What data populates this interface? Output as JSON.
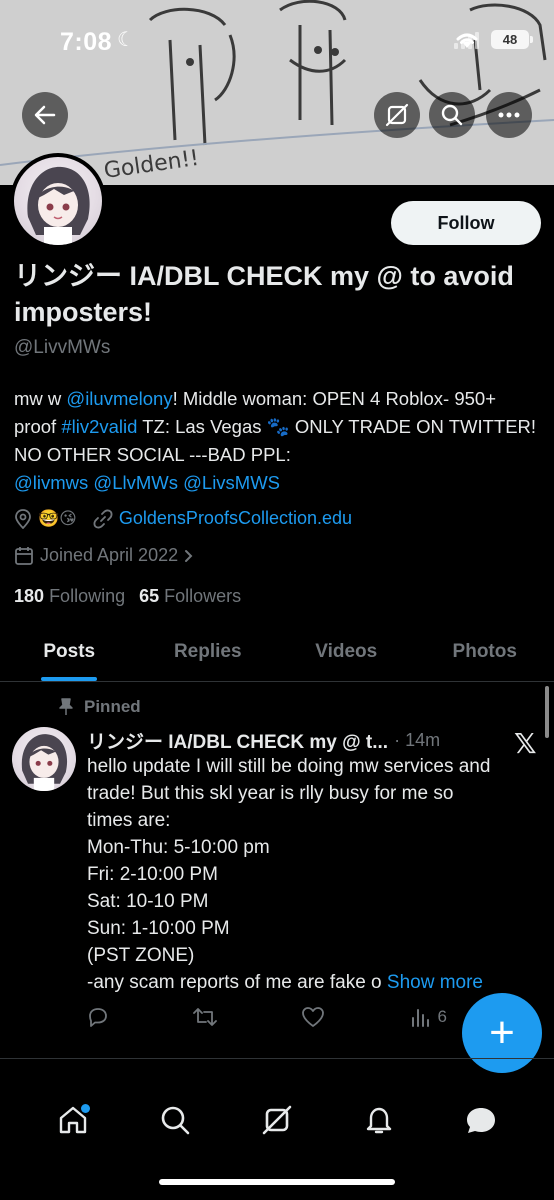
{
  "status_bar": {
    "time": "7:08",
    "battery": "48"
  },
  "banner": {
    "doodle_text": "Golden!!"
  },
  "profile": {
    "follow_label": "Follow",
    "display_name": "リンジー IA/DBL CHECK my @ to avoid imposters!",
    "handle": "@LivvMWs",
    "bio": {
      "p1": "mw w ",
      "mention1": "@iluvmelony",
      "p2": "! Middle woman: OPEN 4 Roblox- 950+ proof ",
      "hashtag": "#liv2valid",
      "p3": " TZ: Las Vegas 🐾 ONLY TRADE ON TWITTER! NO OTHER SOCIAL ---BAD PPL: ",
      "mention2": "@livmws",
      "mention3": "@LlvMWs",
      "mention4": "@LivsMWS"
    },
    "location_emojis": "🤓😘",
    "website": "GoldensProofsCollection.edu",
    "joined": "Joined April 2022",
    "following_count": "180",
    "following_label": "Following",
    "followers_count": "65",
    "followers_label": "Followers"
  },
  "tabs": [
    {
      "label": "Posts",
      "active": true
    },
    {
      "label": "Replies",
      "active": false
    },
    {
      "label": "Videos",
      "active": false
    },
    {
      "label": "Photos",
      "active": false
    }
  ],
  "pinned_post": {
    "pinned_label": "Pinned",
    "author": "リンジー IA/DBL CHECK my @ t...",
    "time": "· 14m",
    "lines": [
      "hello update I will still be doing mw services and",
      "trade! But this skl year is rlly busy for me so",
      "times are:",
      "Mon-Thu: 5-10:00 pm",
      "Fri: 2-10:00 PM",
      "Sat: 10-10 PM",
      "Sun: 1-10:00 PM",
      "(PST ZONE)"
    ],
    "last_line": "-any scam reports of me are fake o",
    "show_more": "Show more",
    "views": "6"
  },
  "fab_label": "+",
  "colors": {
    "accent": "#1d9bf0",
    "background": "#000000",
    "muted": "#71767b"
  },
  "icons": [
    "back-arrow-icon",
    "grok-icon",
    "search-icon",
    "more-icon",
    "location-icon",
    "link-icon",
    "calendar-icon",
    "pin-icon",
    "reply-icon",
    "retweet-icon",
    "like-icon",
    "views-icon",
    "home-icon",
    "explore-icon",
    "grok-nav-icon",
    "notifications-icon",
    "messages-icon"
  ]
}
